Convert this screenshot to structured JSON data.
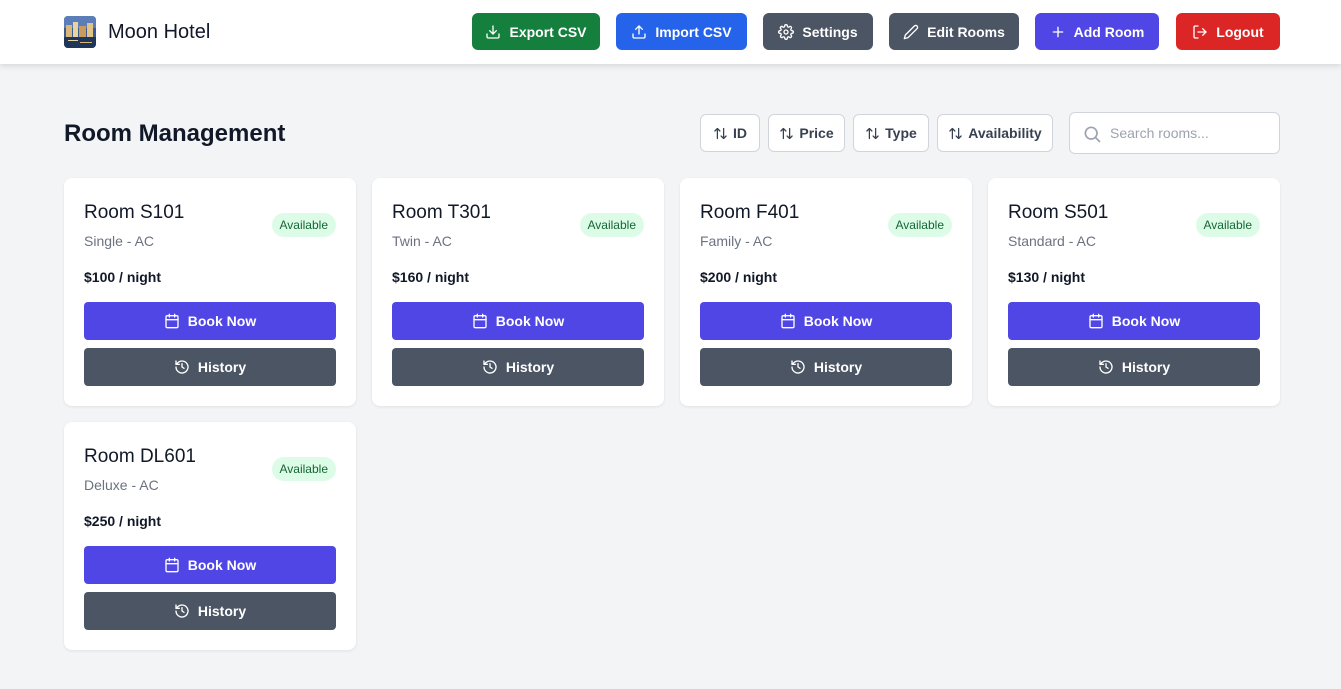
{
  "header": {
    "brand": "Moon Hotel",
    "buttons": {
      "export": "Export CSV",
      "import": "Import CSV",
      "settings": "Settings",
      "edit_rooms": "Edit Rooms",
      "add_room": "Add Room",
      "logout": "Logout"
    }
  },
  "main": {
    "title": "Room Management",
    "sort": {
      "id": "ID",
      "price": "Price",
      "type": "Type",
      "availability": "Availability"
    },
    "search": {
      "placeholder": "Search rooms...",
      "value": ""
    }
  },
  "rooms": [
    {
      "title": "Room S101",
      "type": "Single - AC",
      "status": "Available",
      "price": "$100 / night",
      "book_label": "Book Now",
      "history_label": "History"
    },
    {
      "title": "Room T301",
      "type": "Twin - AC",
      "status": "Available",
      "price": "$160 / night",
      "book_label": "Book Now",
      "history_label": "History"
    },
    {
      "title": "Room F401",
      "type": "Family - AC",
      "status": "Available",
      "price": "$200 / night",
      "book_label": "Book Now",
      "history_label": "History"
    },
    {
      "title": "Room S501",
      "type": "Standard - AC",
      "status": "Available",
      "price": "$130 / night",
      "book_label": "Book Now",
      "history_label": "History"
    },
    {
      "title": "Room DL601",
      "type": "Deluxe - AC",
      "status": "Available",
      "price": "$250 / night",
      "book_label": "Book Now",
      "history_label": "History"
    }
  ],
  "colors": {
    "export": "#15803d",
    "import": "#2563eb",
    "settings": "#4b5563",
    "edit": "#4b5563",
    "add": "#4f46e5",
    "logout": "#dc2626",
    "badge_bg": "#dcfce7",
    "badge_text": "#166534"
  },
  "icons": {
    "export": "download-icon",
    "import": "upload-icon",
    "settings": "gear-icon",
    "edit": "pencil-icon",
    "add": "plus-icon",
    "logout": "logout-icon",
    "sort": "sort-arrows-icon",
    "search": "search-icon",
    "book": "calendar-icon",
    "history": "history-icon"
  }
}
